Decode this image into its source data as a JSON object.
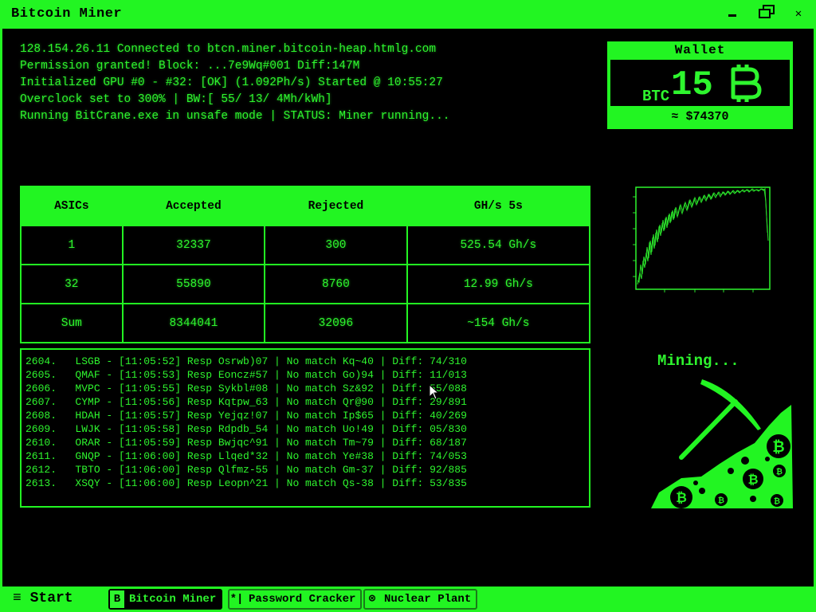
{
  "window": {
    "title": "Bitcoin Miner",
    "min_icon": "minimize-icon",
    "max_icon": "restore-icon",
    "close_icon": "close-icon"
  },
  "console": {
    "lines": [
      "128.154.26.11 Connected to btcn.miner.bitcoin-heap.htmlg.com",
      "Permission granted! Block: ...7e9Wq#001 Diff:147M",
      "Initialized GPU #0 - #32: [OK] (1.092Ph/s) Started @ 10:55:27",
      "Overclock set to 300% | BW:[ 55/ 13/ 4Mh/kWh]",
      "Running BitCrane.exe in unsafe mode | STATUS: Miner running..."
    ]
  },
  "wallet": {
    "title": "Wallet",
    "currency": "BTC",
    "amount": "15",
    "usd": "≈ $74370"
  },
  "stats": {
    "headers": [
      "ASICs",
      "Accepted",
      "Rejected",
      "GH/s 5s"
    ],
    "rows": [
      [
        "1",
        "32337",
        "300",
        "525.54 Gh/s"
      ],
      [
        "32",
        "55890",
        "8760",
        "12.99 Gh/s"
      ],
      [
        "Sum",
        "8344041",
        "32096",
        "~154 Gh/s"
      ]
    ]
  },
  "log": {
    "rows": [
      "2604.   LSGB - [11:05:52] Resp Osrwb)07 | No match Kq~40 | Diff: 74/310",
      "2605.   QMAF - [11:05:53] Resp Eoncz#57 | No match Go)94 | Diff: 11/013",
      "2606.   MVPC - [11:05:55] Resp Sykbl#08 | No match Sz&92 | Diff: 55/088",
      "2607.   CYMP - [11:05:56] Resp Kqtpw_63 | No match Qr@90 | Diff: 29/891",
      "2608.   HDAH - [11:05:57] Resp Yejqz!07 | No match Ip$65 | Diff: 40/269",
      "2609.   LWJK - [11:05:58] Resp Rdpdb_54 | No match Uo!49 | Diff: 05/830",
      "2610.   ORAR - [11:05:59] Resp Bwjqc^91 | No match Tm~79 | Diff: 68/187",
      "2611.   GNQP - [11:06:00] Resp Llqed*32 | No match Ye#38 | Diff: 74/053",
      "2612.   TBTO - [11:06:00] Resp Qlfmz-55 | No match Gm-37 | Diff: 92/885",
      "2613.   XSQY - [11:06:00] Resp Leopn^21 | No match Qs-38 | Diff: 53/835"
    ]
  },
  "mining_label": "Mining...",
  "taskbar": {
    "start_label": "≡ Start",
    "buttons": [
      {
        "icon": "B",
        "label": "Bitcoin Miner",
        "active": true
      },
      {
        "icon": "*|",
        "label": "Password Cracker",
        "active": false
      },
      {
        "icon": "⊗",
        "label": "Nuclear Plant",
        "active": false
      }
    ]
  },
  "colors": {
    "accent": "#22f522",
    "text": "#2ef52e",
    "bg": "#000000"
  }
}
